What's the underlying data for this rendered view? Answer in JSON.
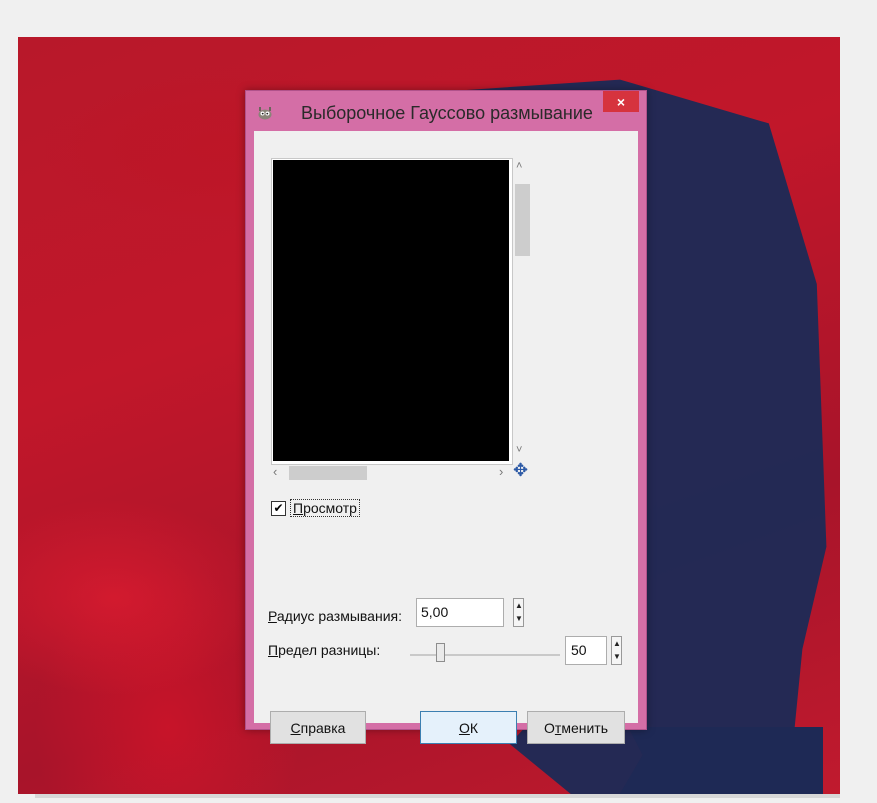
{
  "dialog": {
    "title": "Выборочное Гауссово размывание",
    "close_symbol": "×",
    "icons": {
      "app": "gimp-wilber-icon",
      "close": "close-icon",
      "navigate": "navigate-move-icon"
    },
    "scroll": {
      "up": "˄",
      "down": "˅",
      "left": "‹",
      "right": "›",
      "nav": "✥"
    },
    "preview": {
      "checkbox_mark": "✔",
      "checked": true,
      "label_accel": "П",
      "label_rest": "росмотр"
    },
    "radius": {
      "label_accel": "Р",
      "label_rest": "адиус размывания:",
      "value": "5,00"
    },
    "difference": {
      "label_accel": "П",
      "label_rest": "редел разницы:",
      "value": "50",
      "slider_fraction": 0.2
    },
    "spin_up": "▲",
    "spin_down": "▼",
    "buttons": {
      "help_accel": "С",
      "help_rest": "правка",
      "ok_accel": "О",
      "ok_rest": "К",
      "cancel_pre": "О",
      "cancel_accel": "т",
      "cancel_rest": "менить"
    }
  },
  "colors": {
    "frame": "#d46ea6",
    "close": "#d6333e",
    "background_red": "#c1172a",
    "background_blue": "#1f2a56"
  }
}
